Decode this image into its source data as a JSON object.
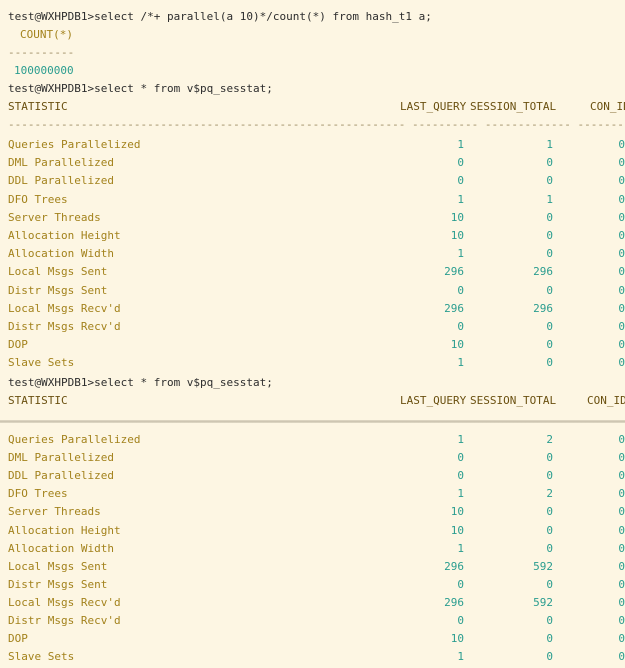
{
  "session1": {
    "cmd": "test@WXHPDB1>select /*+ parallel(a 10)*/count(*) from hash_t1 a;",
    "col": "COUNT(*)",
    "dash": "----------",
    "val": "100000000"
  },
  "query1": {
    "cmd": "test@WXHPDB1>select * from v$pq_sesstat;",
    "h_stat": "STATISTIC",
    "h_last": "LAST_QUERY",
    "h_total": "SESSION_TOTAL",
    "h_con": "CON_ID",
    "dashline": "------------------------------------------------------------ ---------- ------------- ----------",
    "rows": [
      {
        "name": "Queries Parallelized",
        "last": "1",
        "total": "1",
        "con": "0"
      },
      {
        "name": "DML Parallelized",
        "last": "0",
        "total": "0",
        "con": "0"
      },
      {
        "name": "DDL Parallelized",
        "last": "0",
        "total": "0",
        "con": "0"
      },
      {
        "name": "DFO Trees",
        "last": "1",
        "total": "1",
        "con": "0"
      },
      {
        "name": "Server Threads",
        "last": "10",
        "total": "0",
        "con": "0"
      },
      {
        "name": "Allocation Height",
        "last": "10",
        "total": "0",
        "con": "0"
      },
      {
        "name": "Allocation Width",
        "last": "1",
        "total": "0",
        "con": "0"
      },
      {
        "name": "Local Msgs Sent",
        "last": "296",
        "total": "296",
        "con": "0"
      },
      {
        "name": "Distr Msgs Sent",
        "last": "0",
        "total": "0",
        "con": "0"
      },
      {
        "name": "Local Msgs Recv'd",
        "last": "296",
        "total": "296",
        "con": "0"
      },
      {
        "name": "Distr Msgs Recv'd",
        "last": "0",
        "total": "0",
        "con": "0"
      },
      {
        "name": "DOP",
        "last": "10",
        "total": "0",
        "con": "0"
      },
      {
        "name": "Slave Sets",
        "last": "1",
        "total": "0",
        "con": "0"
      }
    ]
  },
  "query2": {
    "cmd": "test@WXHPDB1>select * from v$pq_sesstat;",
    "h_stat": "STATISTIC",
    "h_last": "LAST_QUERY",
    "h_total": "SESSION_TOTAL",
    "h_con": "CON_ID",
    "rows": [
      {
        "name": "Queries Parallelized",
        "last": "1",
        "total": "2",
        "con": "0"
      },
      {
        "name": "DML Parallelized",
        "last": "0",
        "total": "0",
        "con": "0"
      },
      {
        "name": "DDL Parallelized",
        "last": "0",
        "total": "0",
        "con": "0"
      },
      {
        "name": "DFO Trees",
        "last": "1",
        "total": "2",
        "con": "0"
      },
      {
        "name": "Server Threads",
        "last": "10",
        "total": "0",
        "con": "0"
      },
      {
        "name": "Allocation Height",
        "last": "10",
        "total": "0",
        "con": "0"
      },
      {
        "name": "Allocation Width",
        "last": "1",
        "total": "0",
        "con": "0"
      },
      {
        "name": "Local Msgs Sent",
        "last": "296",
        "total": "592",
        "con": "0"
      },
      {
        "name": "Distr Msgs Sent",
        "last": "0",
        "total": "0",
        "con": "0"
      },
      {
        "name": "Local Msgs Recv'd",
        "last": "296",
        "total": "592",
        "con": "0"
      },
      {
        "name": "Distr Msgs Recv'd",
        "last": "0",
        "total": "0",
        "con": "0"
      },
      {
        "name": "DOP",
        "last": "10",
        "total": "0",
        "con": "0"
      },
      {
        "name": "Slave Sets",
        "last": "1",
        "total": "0",
        "con": "0"
      }
    ]
  },
  "colors": {
    "background": "#fdf6e3",
    "name_text": "#a3821c",
    "number_text": "#2a9d8f",
    "prompt_text": "#2d2d2d"
  }
}
